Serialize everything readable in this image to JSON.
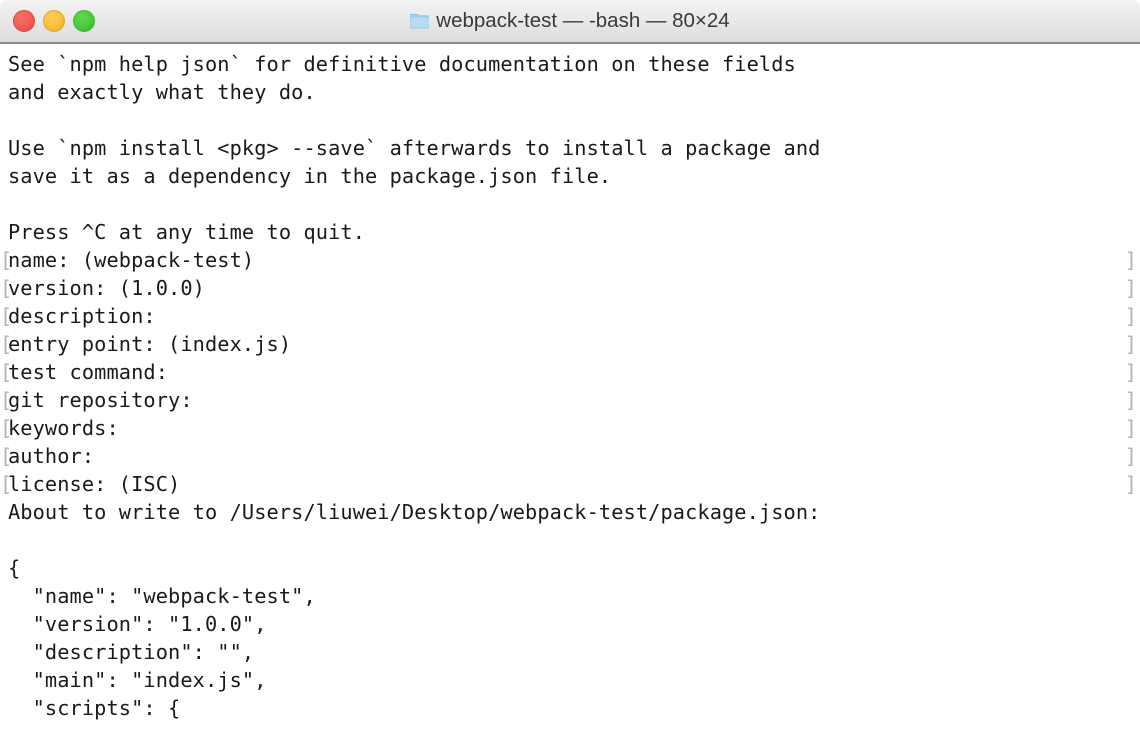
{
  "window": {
    "title": "webpack-test — -bash — 80×24",
    "folder_icon": "folder-icon",
    "traffic_lights": [
      {
        "name": "close-button",
        "label": "Close",
        "color": "#ef5e55"
      },
      {
        "name": "minimize-button",
        "label": "Minimize",
        "color": "#f6bf3f"
      },
      {
        "name": "maximize-button",
        "label": "Maximize",
        "color": "#4bc93c"
      }
    ]
  },
  "terminal": {
    "background": "#ffffff",
    "foreground": "#1a1a1a",
    "wrap_marker_color": "#b3b3b3",
    "cols": 80,
    "rows": 24,
    "shell": "-bash",
    "lines": [
      {
        "type": "text",
        "text": "See `npm help json` for definitive documentation on these fields"
      },
      {
        "type": "text",
        "text": "and exactly what they do."
      },
      {
        "type": "text",
        "text": ""
      },
      {
        "type": "text",
        "text": "Use `npm install <pkg> --save` afterwards to install a package and"
      },
      {
        "type": "text",
        "text": "save it as a dependency in the package.json file."
      },
      {
        "type": "text",
        "text": ""
      },
      {
        "type": "text",
        "text": "Press ^C at any time to quit."
      },
      {
        "type": "prompt",
        "text": "name: (webpack-test)",
        "left": "[",
        "right": "]"
      },
      {
        "type": "prompt",
        "text": "version: (1.0.0)",
        "left": "[",
        "right": "]"
      },
      {
        "type": "prompt",
        "text": "description:",
        "left": "[",
        "right": "]"
      },
      {
        "type": "prompt",
        "text": "entry point: (index.js)",
        "left": "[",
        "right": "]"
      },
      {
        "type": "prompt",
        "text": "test command:",
        "left": "[",
        "right": "]"
      },
      {
        "type": "prompt",
        "text": "git repository:",
        "left": "[",
        "right": "]"
      },
      {
        "type": "prompt",
        "text": "keywords:",
        "left": "[",
        "right": "]"
      },
      {
        "type": "prompt",
        "text": "author:",
        "left": "[",
        "right": "]"
      },
      {
        "type": "prompt",
        "text": "license: (ISC)",
        "left": "[",
        "right": "]"
      },
      {
        "type": "text",
        "text": "About to write to /Users/liuwei/Desktop/webpack-test/package.json:"
      },
      {
        "type": "text",
        "text": ""
      },
      {
        "type": "text",
        "text": "{"
      },
      {
        "type": "text",
        "text": "  \"name\": \"webpack-test\","
      },
      {
        "type": "text",
        "text": "  \"version\": \"1.0.0\","
      },
      {
        "type": "text",
        "text": "  \"description\": \"\","
      },
      {
        "type": "text",
        "text": "  \"main\": \"index.js\","
      },
      {
        "type": "text",
        "text": "  \"scripts\": {"
      }
    ]
  }
}
